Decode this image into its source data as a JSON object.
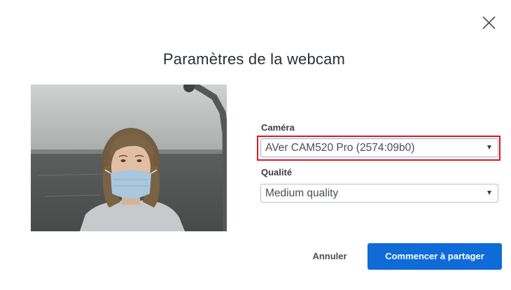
{
  "dialog": {
    "title": "Paramètres de la webcam",
    "close_icon": "close-icon"
  },
  "preview": {
    "description_icon": "webcam-preview-image"
  },
  "camera": {
    "label": "Caméra",
    "selected": "AVer CAM520 Pro (2574:09b0)",
    "highlight_color": "#d9181f"
  },
  "quality": {
    "label": "Qualité",
    "selected": "Medium quality"
  },
  "actions": {
    "cancel_label": "Annuler",
    "start_label": "Commencer à partager",
    "start_color": "#0f6bd7"
  }
}
